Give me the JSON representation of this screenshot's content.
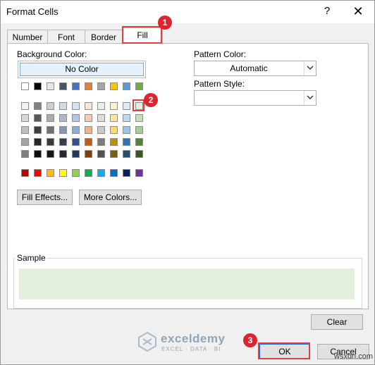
{
  "window": {
    "title": "Format Cells",
    "help": "?",
    "close": "✕"
  },
  "tabs": [
    {
      "label": "Number"
    },
    {
      "label": "Font"
    },
    {
      "label": "Border"
    },
    {
      "label": "Fill",
      "active": true
    }
  ],
  "fill": {
    "background_color_label": "Background Color:",
    "no_color_label": "No Color",
    "pattern_color_label": "Pattern Color:",
    "pattern_color_value": "Automatic",
    "pattern_style_label": "Pattern Style:",
    "pattern_style_value": "",
    "fill_effects_label": "Fill Effects...",
    "more_colors_label": "More Colors...",
    "sample_label": "Sample",
    "sample_color": "#e2efda",
    "clear_label": "Clear"
  },
  "palette": {
    "theme_row": [
      "#ffffff",
      "#000000",
      "#e7e6e6",
      "#44546a",
      "#4472c4",
      "#ed7d31",
      "#a5a5a5",
      "#ffc000",
      "#5b9bd5",
      "#70ad47"
    ],
    "shades": [
      [
        "#f2f2f2",
        "#7f7f7f",
        "#d0cece",
        "#d6dce4",
        "#d9e2f3",
        "#fbe5d5",
        "#ededed",
        "#fff2cc",
        "#deebf6",
        "#e2efda"
      ],
      [
        "#d8d8d8",
        "#595959",
        "#aeaaaa",
        "#adb9ca",
        "#b4c6e7",
        "#f7cbac",
        "#dbdbdb",
        "#fee599",
        "#bdd7ee",
        "#c5e0b3"
      ],
      [
        "#bfbfbf",
        "#3f3f3f",
        "#757070",
        "#8496b0",
        "#8eaadb",
        "#f4b183",
        "#c9c9c9",
        "#ffd966",
        "#9cc3e5",
        "#a8d08d"
      ],
      [
        "#a5a5a5",
        "#262626",
        "#3a3838",
        "#323f4f",
        "#2f5496",
        "#c55a11",
        "#7b7b7b",
        "#bf9000",
        "#2e75b5",
        "#538135"
      ],
      [
        "#7f7f7f",
        "#0c0c0c",
        "#171616",
        "#222a35",
        "#1f3864",
        "#833c0b",
        "#525252",
        "#7f6000",
        "#1e4e79",
        "#375623"
      ]
    ],
    "standard_row": [
      "#c00000",
      "#ff0000",
      "#ffc000",
      "#ffff00",
      "#92d050",
      "#00b050",
      "#00b0f0",
      "#0070c0",
      "#002060",
      "#7030a0"
    ]
  },
  "buttons": {
    "ok_label": "OK",
    "cancel_label": "Cancel"
  },
  "annotations": [
    "1",
    "2",
    "3"
  ],
  "watermark": {
    "name": "exceldemy",
    "subtitle": "EXCEL · DATA · BI",
    "site": "wsxdn.com"
  }
}
